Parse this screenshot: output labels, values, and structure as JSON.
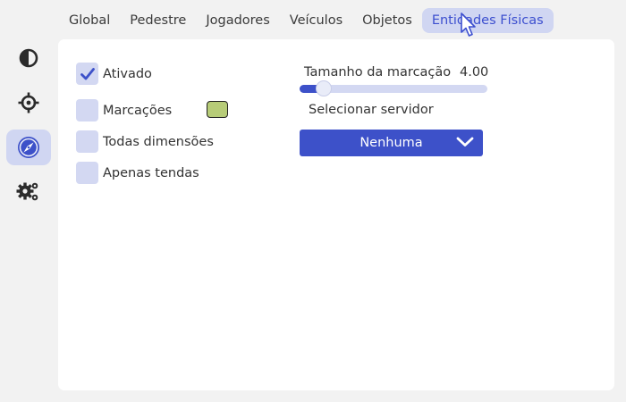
{
  "tabs": [
    {
      "label": "Global",
      "active": false
    },
    {
      "label": "Pedestre",
      "active": false
    },
    {
      "label": "Jogadores",
      "active": false
    },
    {
      "label": "Veículos",
      "active": false
    },
    {
      "label": "Objetos",
      "active": false
    },
    {
      "label": "Entidades Físicas",
      "active": true
    }
  ],
  "sidebar": {
    "items": [
      {
        "icon": "contrast-icon",
        "active": false
      },
      {
        "icon": "crosshair-icon",
        "active": false
      },
      {
        "icon": "compass-icon",
        "active": true
      },
      {
        "icon": "gears-icon",
        "active": false
      }
    ]
  },
  "options": {
    "enabled": {
      "label": "Ativado",
      "checked": true
    },
    "markers": {
      "label": "Marcações",
      "checked": false,
      "color": "#b7cc78"
    },
    "all_dimensions": {
      "label": "Todas dimensões",
      "checked": false
    },
    "tents_only": {
      "label": "Apenas tendas",
      "checked": false
    }
  },
  "marker_size": {
    "label": "Tamanho da marcação",
    "value": "4.00",
    "fraction": 0.13
  },
  "server": {
    "label": "Selecionar servidor",
    "selected": "Nenhuma"
  },
  "colors": {
    "accent": "#3d51c9",
    "accent_light": "#d0d6f2"
  }
}
